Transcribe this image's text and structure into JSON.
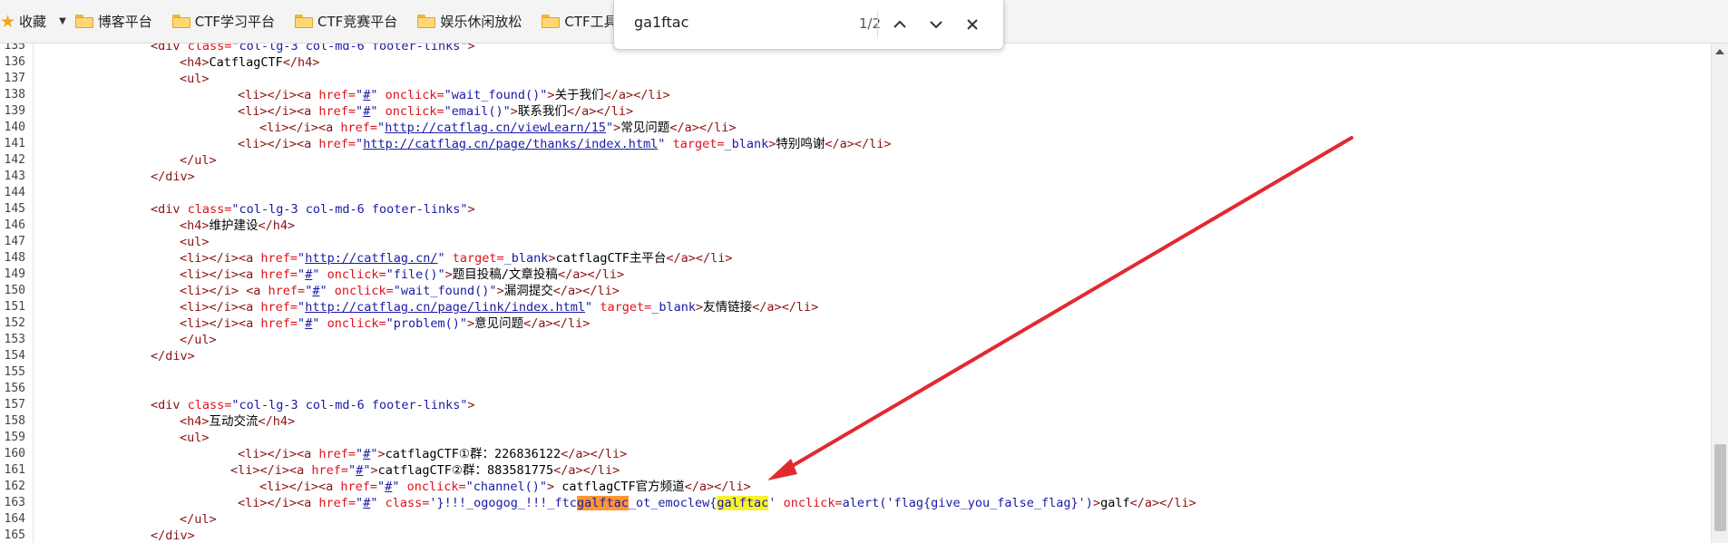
{
  "bookmarks": {
    "favorites_label": "收藏",
    "items": [
      "博客平台",
      "CTF学习平台",
      "CTF竞赛平台",
      "娱乐休闲放松",
      "CTF工具"
    ]
  },
  "find": {
    "query": "ga1ftac",
    "count": "1/2"
  },
  "code": {
    "line_numbers": [
      "135",
      "136",
      "137",
      "138",
      "139",
      "140",
      "141",
      "142",
      "143",
      "144",
      "145",
      "146",
      "147",
      "148",
      "149",
      "150",
      "151",
      "152",
      "153",
      "154",
      "155",
      "156",
      "157",
      "158",
      "159",
      "160",
      "161",
      "162",
      "163",
      "164",
      "165"
    ]
  },
  "colors": {
    "tag": "#8b1212",
    "attribute": "#e0101a",
    "value": "#1a1aa6",
    "current_match": "#ff9632",
    "other_match": "#f8f22a",
    "arrow": "#e12a2f"
  }
}
